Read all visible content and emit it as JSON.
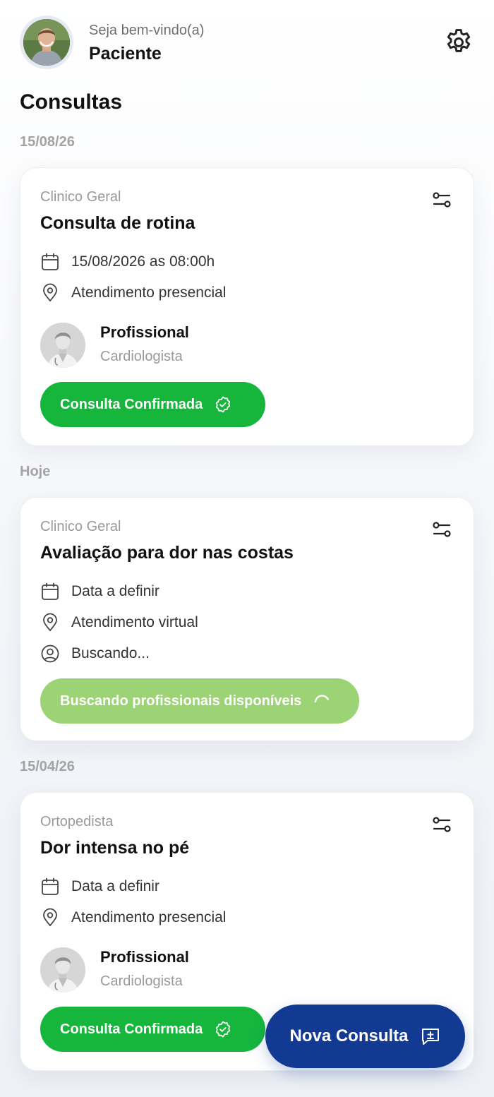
{
  "header": {
    "welcome": "Seja bem-vindo(a)",
    "user_name": "Paciente",
    "avatar": "user-photo",
    "settings_icon": "gear-icon"
  },
  "page_title": "Consultas",
  "groups": [
    {
      "date_label": "15/08/26",
      "card": {
        "specialty": "Clinico Geral",
        "title": "Consulta de rotina",
        "schedule": "15/08/2026 as 08:00h",
        "mode": "Atendimento presencial",
        "professional": {
          "name": "Profissional",
          "specialty": "Cardiologista"
        },
        "status": "Consulta Confirmada",
        "status_color": "#16b63c"
      }
    },
    {
      "date_label": "Hoje",
      "card": {
        "specialty": "Clinico Geral",
        "title": "Avaliação para dor nas costas",
        "schedule": "Data a definir",
        "mode": "Atendimento virtual",
        "professional_search": "Buscando...",
        "status": "Buscando profissionais disponíveis",
        "status_color": "#9bd375"
      }
    },
    {
      "date_label": "15/04/26",
      "card": {
        "specialty": "Ortopedista",
        "title": "Dor intensa no pé",
        "schedule": "Data a definir",
        "mode": "Atendimento presencial",
        "professional": {
          "name": "Profissional",
          "specialty": "Cardiologista"
        },
        "status": "Consulta Confirmada",
        "status_color": "#16b63c"
      }
    }
  ],
  "fab": {
    "label": "Nova Consulta",
    "color": "#123a93",
    "icon": "new-message-icon"
  }
}
